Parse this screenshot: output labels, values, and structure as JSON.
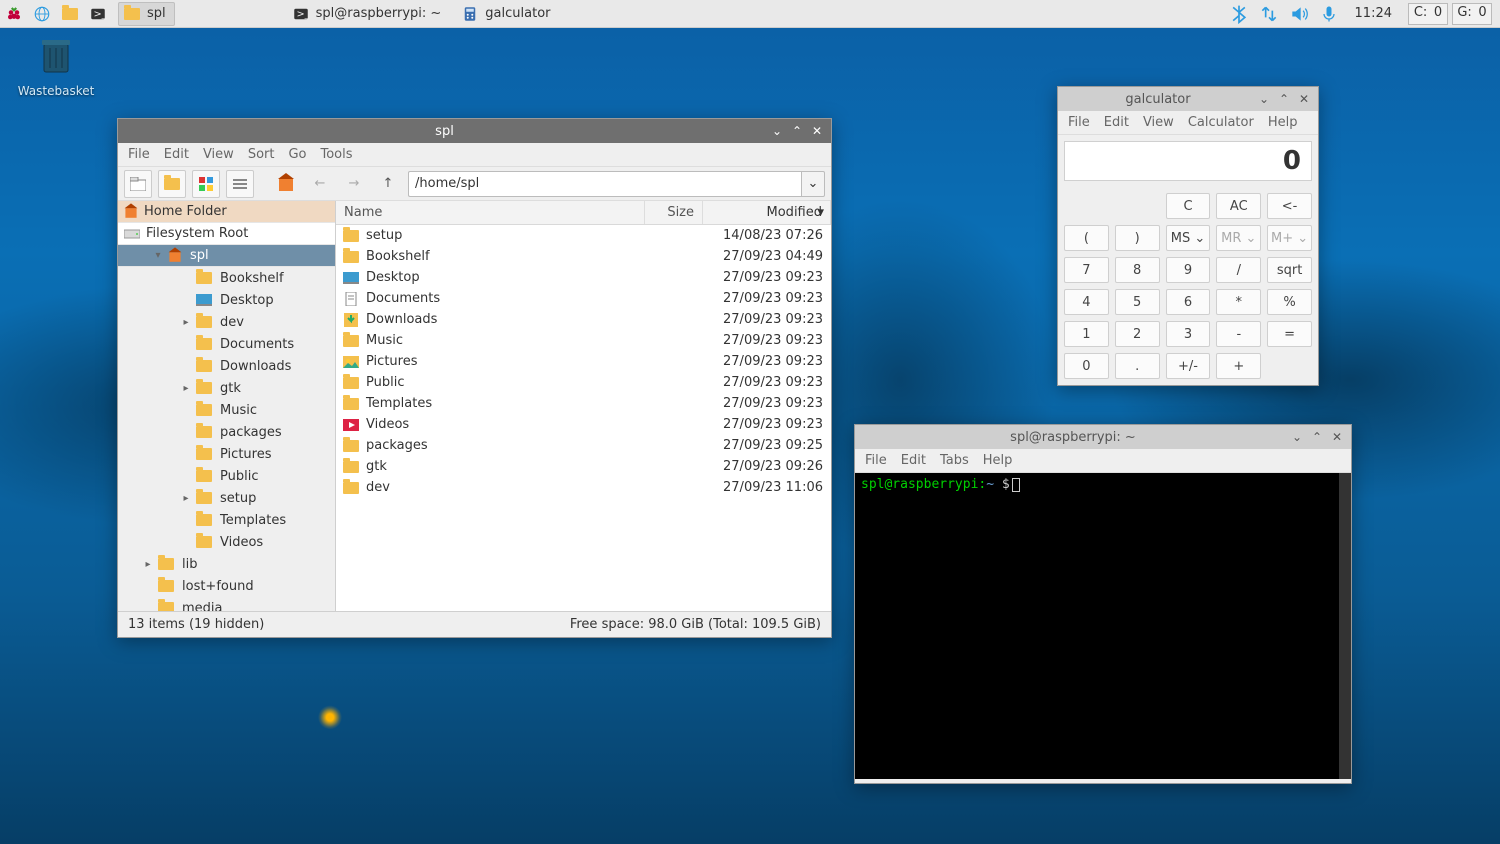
{
  "taskbar": {
    "items": [
      {
        "label": "spl",
        "iconName": "folder-icon",
        "active": true
      },
      {
        "label": "spl@raspberrypi: ~",
        "iconName": "terminal-icon",
        "active": false
      },
      {
        "label": "galculator",
        "iconName": "calculator-icon",
        "active": false
      }
    ],
    "time": "11:24",
    "trayBoxes": [
      {
        "label": "C:",
        "value": "0"
      },
      {
        "label": "G:",
        "value": "0"
      }
    ]
  },
  "desktopIcon": {
    "label": "Wastebasket"
  },
  "fileManager": {
    "title": "spl",
    "menus": [
      "File",
      "Edit",
      "View",
      "Sort",
      "Go",
      "Tools"
    ],
    "path": "/home/spl",
    "places": {
      "home": "Home Folder",
      "root": "Filesystem Root"
    },
    "tree": [
      {
        "depth": 0,
        "label": "spl",
        "exp": "▾",
        "icon": "home",
        "sel": true
      },
      {
        "depth": 1,
        "label": "Bookshelf",
        "icon": "folder"
      },
      {
        "depth": 1,
        "label": "Desktop",
        "icon": "desktop"
      },
      {
        "depth": 1,
        "label": "dev",
        "icon": "folder",
        "exp": "▸"
      },
      {
        "depth": 1,
        "label": "Documents",
        "icon": "folder"
      },
      {
        "depth": 1,
        "label": "Downloads",
        "icon": "folder"
      },
      {
        "depth": 1,
        "label": "gtk",
        "icon": "folder",
        "exp": "▸"
      },
      {
        "depth": 1,
        "label": "Music",
        "icon": "folder"
      },
      {
        "depth": 1,
        "label": "packages",
        "icon": "folder"
      },
      {
        "depth": 1,
        "label": "Pictures",
        "icon": "folder"
      },
      {
        "depth": 1,
        "label": "Public",
        "icon": "folder"
      },
      {
        "depth": 1,
        "label": "setup",
        "icon": "folder",
        "exp": "▸"
      },
      {
        "depth": 1,
        "label": "Templates",
        "icon": "folder"
      },
      {
        "depth": 1,
        "label": "Videos",
        "icon": "folder"
      },
      {
        "depth": -1,
        "label": "lib",
        "icon": "folder",
        "exp": "▸"
      },
      {
        "depth": -1,
        "label": "lost+found",
        "icon": "folder"
      },
      {
        "depth": -1,
        "label": "media",
        "icon": "folder"
      }
    ],
    "columns": {
      "name": "Name",
      "size": "Size",
      "modified": "Modified"
    },
    "files": [
      {
        "name": "setup",
        "icon": "folder",
        "mod": "14/08/23 07:26"
      },
      {
        "name": "Bookshelf",
        "icon": "folder",
        "mod": "27/09/23 04:49"
      },
      {
        "name": "Desktop",
        "icon": "desktop",
        "mod": "27/09/23 09:23"
      },
      {
        "name": "Documents",
        "icon": "docs",
        "mod": "27/09/23 09:23"
      },
      {
        "name": "Downloads",
        "icon": "downloads",
        "mod": "27/09/23 09:23"
      },
      {
        "name": "Music",
        "icon": "music",
        "mod": "27/09/23 09:23"
      },
      {
        "name": "Pictures",
        "icon": "pictures",
        "mod": "27/09/23 09:23"
      },
      {
        "name": "Public",
        "icon": "public",
        "mod": "27/09/23 09:23"
      },
      {
        "name": "Templates",
        "icon": "templates",
        "mod": "27/09/23 09:23"
      },
      {
        "name": "Videos",
        "icon": "videos",
        "mod": "27/09/23 09:23"
      },
      {
        "name": "packages",
        "icon": "folder",
        "mod": "27/09/23 09:25"
      },
      {
        "name": "gtk",
        "icon": "folder",
        "mod": "27/09/23 09:26"
      },
      {
        "name": "dev",
        "icon": "folder",
        "mod": "27/09/23 11:06"
      }
    ],
    "statusLeft": "13 items (19 hidden)",
    "statusRight": "Free space: 98.0 GiB (Total: 109.5 GiB)"
  },
  "calculator": {
    "title": "galculator",
    "menus": [
      "File",
      "Edit",
      "View",
      "Calculator",
      "Help"
    ],
    "display": "0",
    "rows": [
      [
        null,
        null,
        "C",
        "AC",
        "<-"
      ],
      [
        "(",
        ")",
        "MS ⌄",
        "MR ⌄",
        "M+ ⌄"
      ],
      [
        "7",
        "8",
        "9",
        "/",
        "sqrt"
      ],
      [
        "4",
        "5",
        "6",
        "*",
        "%"
      ],
      [
        "1",
        "2",
        "3",
        "-",
        "="
      ],
      [
        "0",
        ".",
        "+/-",
        "+",
        null
      ]
    ]
  },
  "terminal": {
    "title": "spl@raspberrypi: ~",
    "menus": [
      "File",
      "Edit",
      "Tabs",
      "Help"
    ],
    "promptUser": "spl@raspberrypi",
    "promptPath": "~",
    "promptSymbol": "$"
  }
}
